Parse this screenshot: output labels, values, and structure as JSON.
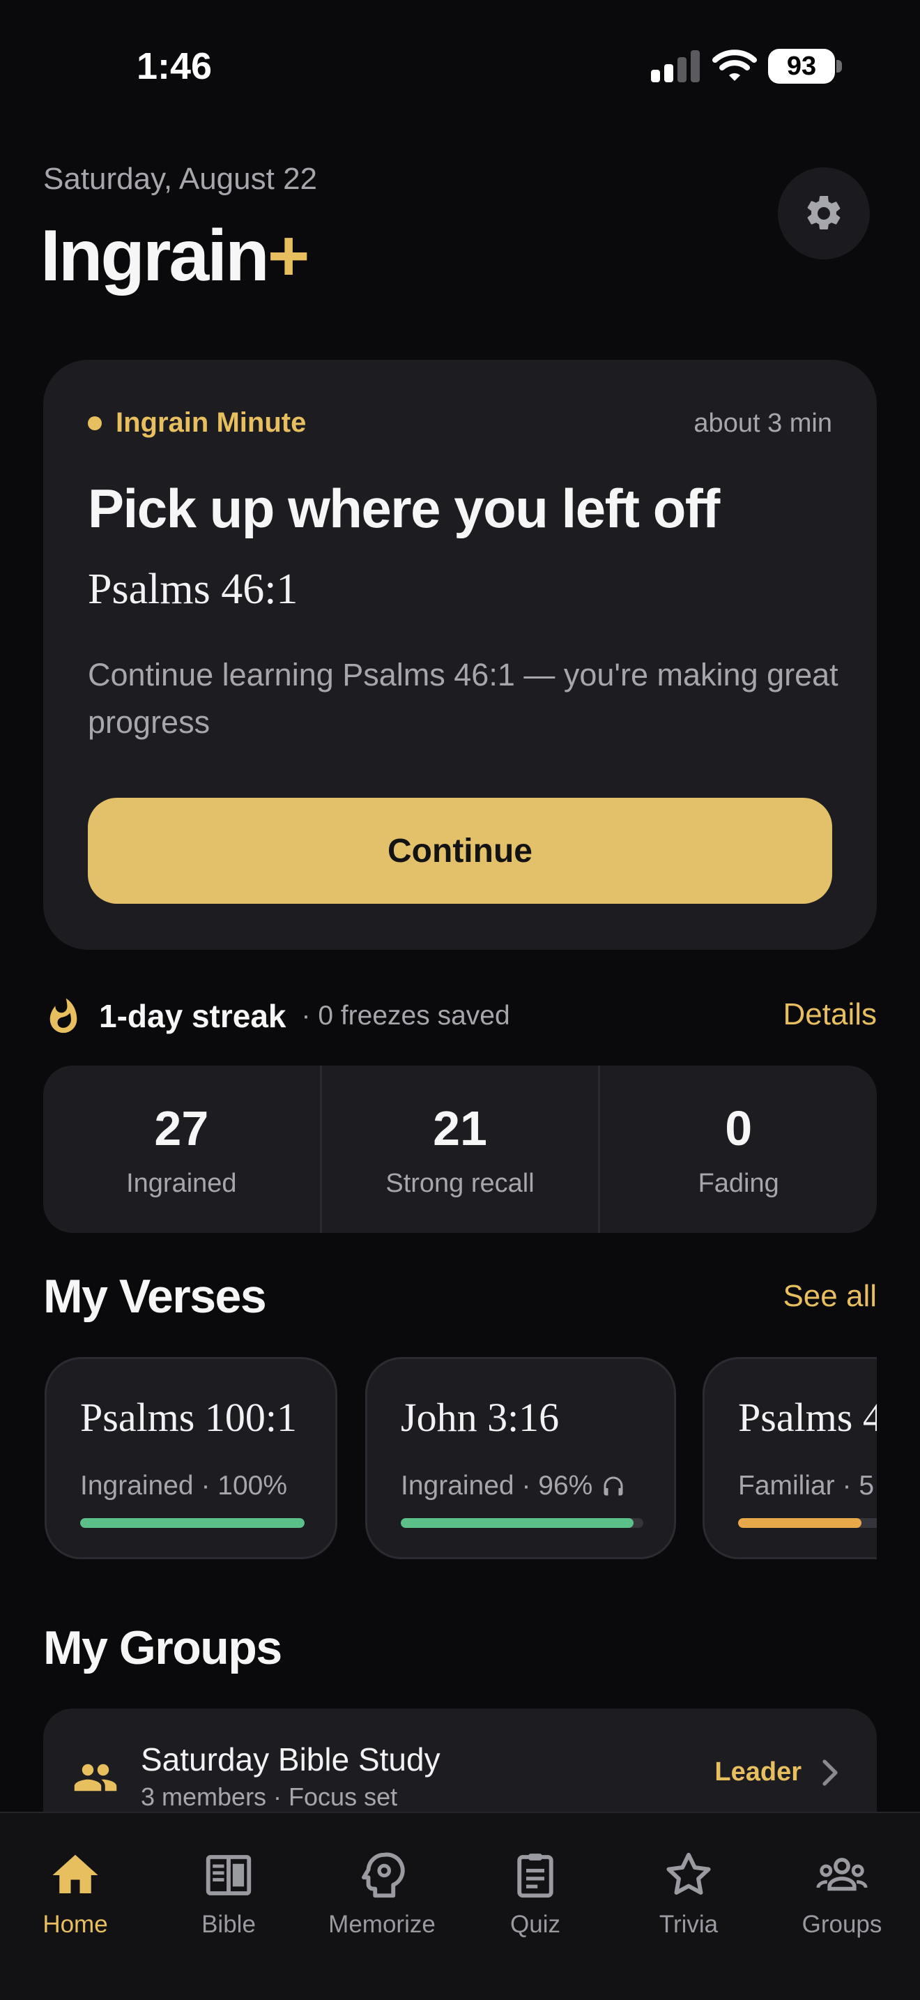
{
  "status_bar": {
    "time": "1:46",
    "battery": "93"
  },
  "header": {
    "date": "Saturday, August 22",
    "app_name": "Ingrain",
    "app_name_suffix": "+"
  },
  "minute_card": {
    "tag": "Ingrain Minute",
    "duration": "about 3 min",
    "headline": "Pick up where you left off",
    "verse": "Psalms 46:1",
    "description": "Continue learning Psalms 46:1 — you're making great progress",
    "button_label": "Continue"
  },
  "streak": {
    "label": "1-day streak",
    "freezes": "· 0 freezes saved",
    "details_label": "Details"
  },
  "stats": [
    {
      "value": "27",
      "label": "Ingrained"
    },
    {
      "value": "21",
      "label": "Strong recall"
    },
    {
      "value": "0",
      "label": "Fading"
    }
  ],
  "my_verses": {
    "title": "My Verses",
    "see_all": "See all",
    "items": [
      {
        "reference": "Psalms 100:1",
        "status": "Ingrained · 100%",
        "progress": 1.0,
        "color": "#5cc189",
        "audio": false
      },
      {
        "reference": "John 3:16",
        "status": "Ingrained · 96%",
        "progress": 0.96,
        "color": "#5cc189",
        "audio": true
      },
      {
        "reference": "Psalms 4",
        "status": "Familiar · 5",
        "progress": 0.55,
        "color": "#e8a94a",
        "audio": false
      }
    ]
  },
  "my_groups": {
    "title": "My Groups",
    "items": [
      {
        "name": "Saturday Bible Study",
        "meta": "3 members · Focus set",
        "role": "Leader"
      }
    ]
  },
  "tabs": [
    {
      "label": "Home",
      "icon": "home-icon",
      "active": true
    },
    {
      "label": "Bible",
      "icon": "book-icon",
      "active": false
    },
    {
      "label": "Memorize",
      "icon": "brain-head-icon",
      "active": false
    },
    {
      "label": "Quiz",
      "icon": "clipboard-icon",
      "active": false
    },
    {
      "label": "Trivia",
      "icon": "star-icon",
      "active": false
    },
    {
      "label": "Groups",
      "icon": "people-icon",
      "active": false
    }
  ],
  "colors": {
    "accent": "#e8bf5f",
    "background": "#0a0a0c",
    "card": "#1c1c21",
    "success": "#5cc189",
    "warning": "#e8a94a"
  }
}
